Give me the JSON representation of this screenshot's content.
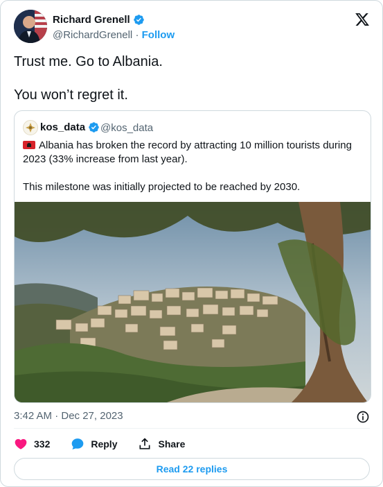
{
  "author": {
    "name": "Richard Grenell",
    "handle": "@RichardGrenell",
    "separator": "·",
    "follow_label": "Follow"
  },
  "tweet": {
    "lines": [
      "Trust me. Go to Albania.",
      "You won’t regret it."
    ]
  },
  "quote": {
    "name": "kos_data",
    "handle": "@kos_data",
    "line1": "Albania has broken the record by attracting 10 million tourists during 2023 (33% increase from last year).",
    "line2": "This milestone was initially projected to be reached by 2030.",
    "flag_icon": "albania-flag-icon"
  },
  "timestamp": "3:42 AM · Dec 27, 2023",
  "actions": {
    "like_count": "332",
    "reply_label": "Reply",
    "share_label": "Share"
  },
  "read_replies_label": "Read 22 replies",
  "colors": {
    "accent": "#1d9bf0",
    "heart": "#f91880",
    "muted": "#536471",
    "border": "#cfd9de"
  }
}
